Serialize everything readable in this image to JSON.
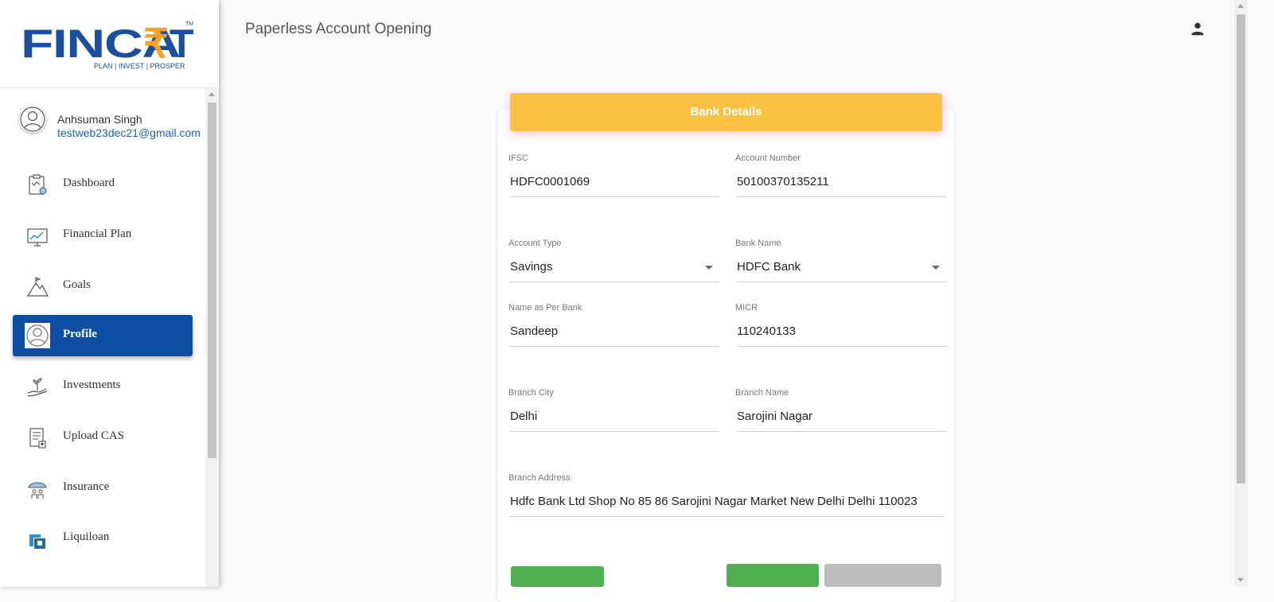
{
  "logo": {
    "text": "FINCART",
    "tagline": "PLAN | INVEST | PROSPER",
    "tm": "TM"
  },
  "user": {
    "name": "Anhsuman Singh",
    "email": "testweb23dec21@gmail.com"
  },
  "nav": [
    {
      "label": "Dashboard",
      "icon": "dashboard-icon"
    },
    {
      "label": "Financial Plan",
      "icon": "chart-icon"
    },
    {
      "label": "Goals",
      "icon": "mountain-flag-icon"
    },
    {
      "label": "Profile",
      "icon": "user-icon",
      "active": true
    },
    {
      "label": "Investments",
      "icon": "plant-hand-icon"
    },
    {
      "label": "Upload CAS",
      "icon": "document-upload-icon"
    },
    {
      "label": "Insurance",
      "icon": "umbrella-family-icon"
    },
    {
      "label": "Liquiloan",
      "icon": "liquiloan-icon"
    }
  ],
  "header": {
    "title": "Paperless Account Opening"
  },
  "card": {
    "title": "Bank Details",
    "fields": {
      "ifsc": {
        "label": "IFSC",
        "value": "HDFC0001069"
      },
      "account_number": {
        "label": "Account Number",
        "value": "50100370135211"
      },
      "account_type": {
        "label": "Account Type",
        "value": "Savings"
      },
      "bank_name": {
        "label": "Bank Name",
        "value": "HDFC Bank"
      },
      "name_as_per_bank": {
        "label": "Name as Per Bank",
        "value": "Sandeep"
      },
      "micr": {
        "label": "MICR",
        "value": "110240133"
      },
      "branch_city": {
        "label": "Branch City",
        "value": "Delhi"
      },
      "branch_name": {
        "label": "Branch Name",
        "value": "Sarojini Nagar"
      },
      "branch_address": {
        "label": "Branch Address",
        "value": "Hdfc Bank Ltd Shop No 85 86 Sarojini Nagar Market New Delhi Delhi 110023"
      }
    }
  },
  "colors": {
    "accent": "#fcc142",
    "nav_active": "#0d4ea3",
    "brand_blue": "#1a4fa0",
    "brand_orange": "#f6a21e",
    "button_green": "#4caf50",
    "button_disabled": "#bdbdbd"
  }
}
